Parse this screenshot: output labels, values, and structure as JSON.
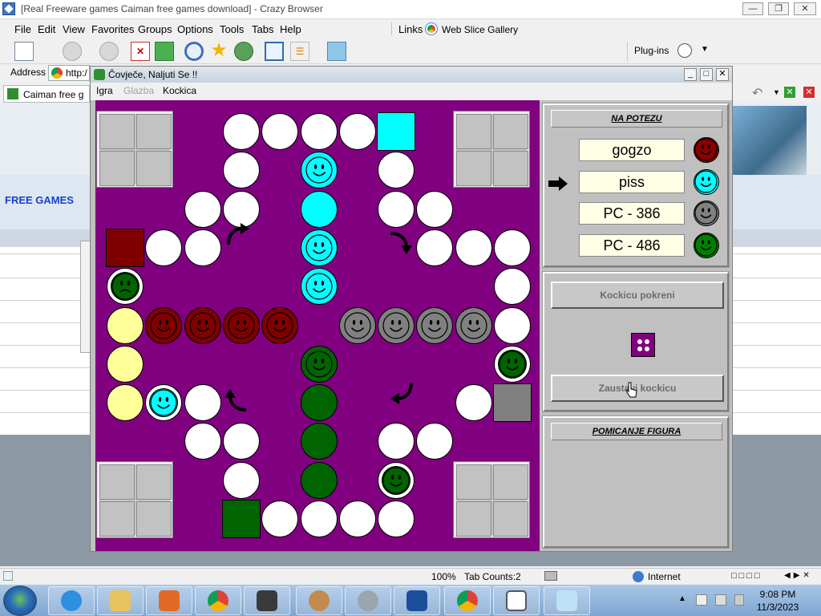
{
  "browser": {
    "title": "[Real Freeware games Caiman free games download] - Crazy Browser",
    "menu": [
      "File",
      "Edit",
      "View",
      "Favorites",
      "Groups",
      "Options",
      "Tools",
      "Tabs",
      "Help"
    ],
    "links_label": "Links",
    "web_slice": "Web Slice Gallery",
    "plugins": "Plug-ins",
    "address_label": "Address",
    "address_value": "http:/",
    "tab_label": "Caiman free g",
    "page_free_games": "FREE GAMES"
  },
  "status": {
    "zoom": "100%",
    "tab_counts": "Tab Counts:2",
    "zone": "Internet"
  },
  "game": {
    "title": "Čovječe, Naljuti Se !!",
    "menu": [
      {
        "label": "Igra",
        "enabled": true
      },
      {
        "label": "Glazba",
        "enabled": false
      },
      {
        "label": "Kockica",
        "enabled": true
      }
    ],
    "colors": {
      "board": "#800080",
      "red": "#800000",
      "cyan": "#00ffff",
      "gray": "#808080",
      "green": "#006400",
      "yellow": "#ffff99"
    },
    "turn_panel": {
      "header": "NA POTEZU",
      "players": [
        {
          "name": "gogzo",
          "color": "#8b0000"
        },
        {
          "name": "piss",
          "color": "#00ffff"
        },
        {
          "name": "PC - 386",
          "color": "#808080"
        },
        {
          "name": "PC - 486",
          "color": "#008000"
        }
      ],
      "current_player_index": 1
    },
    "dice_panel": {
      "start_button": "Kockicu pokreni",
      "stop_button": "Zaustavi kockicu",
      "dice_value": 4
    },
    "move_panel": {
      "header": "POMICANJE FIGURA"
    }
  },
  "taskbar": {
    "time": "9:08 PM",
    "date": "11/3/2023"
  }
}
